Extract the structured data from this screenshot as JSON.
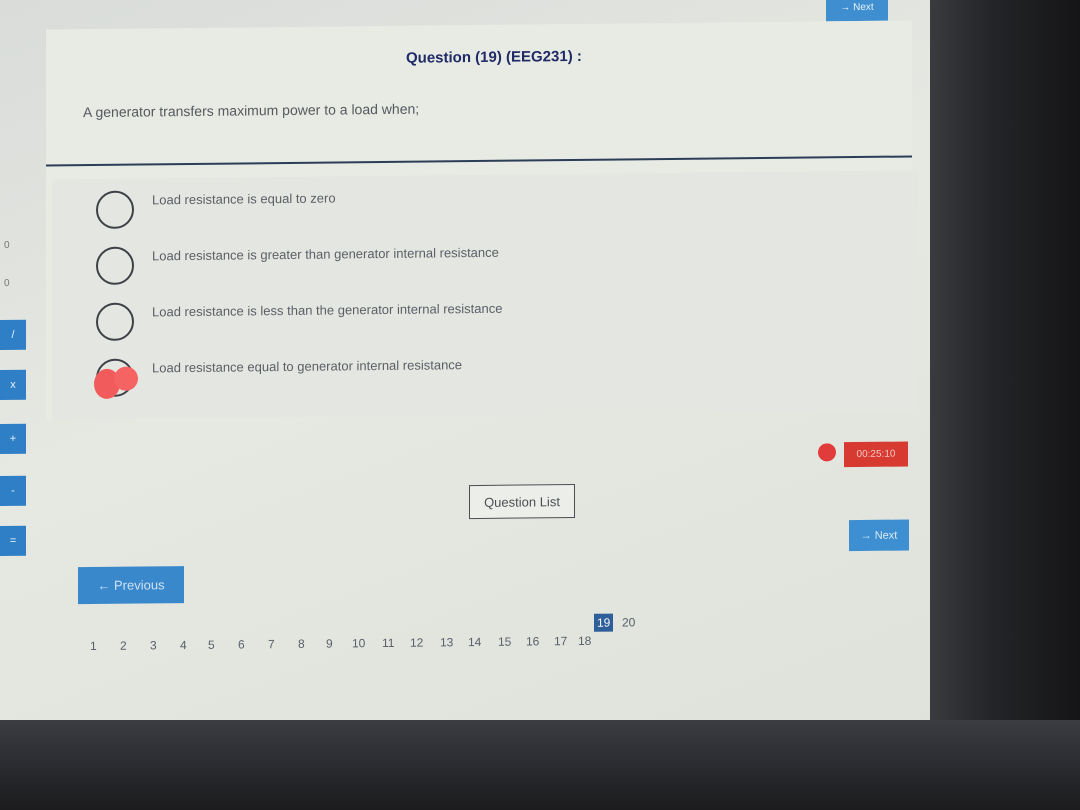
{
  "header": {
    "top_button_label": "→ Next",
    "question_title": "Question (19) (EEG231) :"
  },
  "question": {
    "text": "A generator transfers maximum power to a load when;"
  },
  "options": [
    {
      "label": "Load resistance is equal to zero",
      "selected": false
    },
    {
      "label": "Load resistance is greater than generator internal resistance",
      "selected": false
    },
    {
      "label": "Load resistance is less than the generator internal resistance",
      "selected": false
    },
    {
      "label": "Load resistance equal to generator internal resistance",
      "selected": true
    }
  ],
  "left_keys": [
    "0",
    "0",
    "/",
    "x",
    "+",
    "-",
    "="
  ],
  "timer": {
    "value": "00:25:10",
    "color": "#d63a31"
  },
  "buttons": {
    "question_list": "Question List",
    "next": "→ Next",
    "previous": "← Previous"
  },
  "pager": {
    "pages": [
      "1",
      "2",
      "3",
      "4",
      "5",
      "6",
      "7",
      "8",
      "9",
      "10",
      "11",
      "12",
      "13",
      "14",
      "15",
      "16",
      "17",
      "18",
      "19",
      "20"
    ],
    "current": "19"
  },
  "colors": {
    "accent": "#3a88cc",
    "title": "#1f2a66",
    "timer": "#d63a31",
    "selected": "#f25b5b"
  }
}
